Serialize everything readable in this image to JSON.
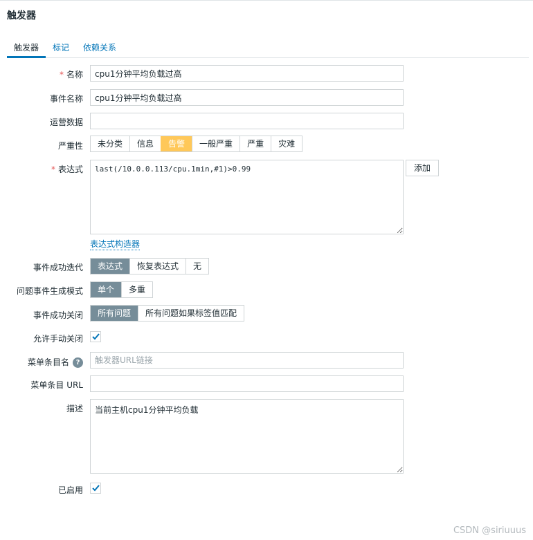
{
  "page": {
    "title": "触发器"
  },
  "tabs": [
    {
      "label": "触发器",
      "active": true
    },
    {
      "label": "标记",
      "active": false
    },
    {
      "label": "依赖关系",
      "active": false
    }
  ],
  "form": {
    "name": {
      "label": "名称",
      "required": true,
      "value": "cpu1分钟平均负载过高"
    },
    "event_name": {
      "label": "事件名称",
      "value": "cpu1分钟平均负载过高"
    },
    "operational_data": {
      "label": "运营数据",
      "value": ""
    },
    "severity": {
      "label": "严重性",
      "options": [
        "未分类",
        "信息",
        "告警",
        "一般严重",
        "严重",
        "灾难"
      ],
      "selected": "告警",
      "selected_color": "#ffc859"
    },
    "expression": {
      "label": "表达式",
      "required": true,
      "value": "last(/10.0.0.113/cpu.1min,#1)>0.99",
      "add_label": "添加",
      "constructor_link": "表达式构造器"
    },
    "ok_event_generation": {
      "label": "事件成功迭代",
      "options": [
        "表达式",
        "恢复表达式",
        "无"
      ],
      "selected": "表达式"
    },
    "problem_event_mode": {
      "label": "问题事件生成模式",
      "options": [
        "单个",
        "多重"
      ],
      "selected": "单个"
    },
    "ok_event_closes": {
      "label": "事件成功关闭",
      "options": [
        "所有问题",
        "所有问题如果标签值匹配"
      ],
      "selected": "所有问题"
    },
    "allow_manual_close": {
      "label": "允许手动关闭",
      "checked": true
    },
    "menu_entry_name": {
      "label": "菜单条目名",
      "placeholder": "触发器URL链接",
      "value": ""
    },
    "menu_entry_url": {
      "label": "菜单条目 URL",
      "value": ""
    },
    "description": {
      "label": "描述",
      "value": "当前主机cpu1分钟平均负载"
    },
    "enabled": {
      "label": "已启用",
      "checked": true
    }
  },
  "watermark": "CSDN @siriuuus",
  "colors": {
    "accent": "#0275b8",
    "selected_gray": "#768d99",
    "required": "#e45959"
  }
}
